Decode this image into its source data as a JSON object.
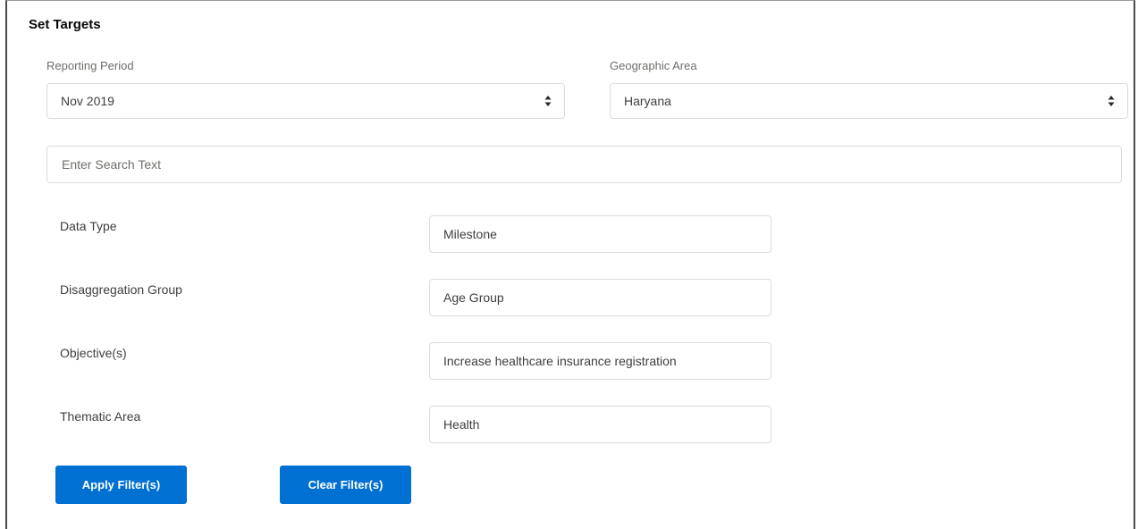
{
  "page": {
    "title": "Set Targets"
  },
  "filters": {
    "reporting_period": {
      "label": "Reporting Period",
      "value": "Nov 2019"
    },
    "geographic_area": {
      "label": "Geographic Area",
      "value": "Haryana"
    }
  },
  "search": {
    "placeholder": "Enter Search Text",
    "value": ""
  },
  "rows": {
    "data_type": {
      "label": "Data Type",
      "value": "Milestone"
    },
    "disaggregation_group": {
      "label": "Disaggregation Group",
      "value": "Age Group"
    },
    "objectives": {
      "label": "Objective(s)",
      "value": "Increase healthcare insurance registration"
    },
    "thematic_area": {
      "label": "Thematic Area",
      "value": "Health"
    }
  },
  "buttons": {
    "apply_label": "Apply Filter(s)",
    "clear_label": "Clear Filter(s)"
  },
  "colors": {
    "brand_button": "#0070d2",
    "field_border": "#dddbda",
    "label_text": "#706e6b"
  }
}
